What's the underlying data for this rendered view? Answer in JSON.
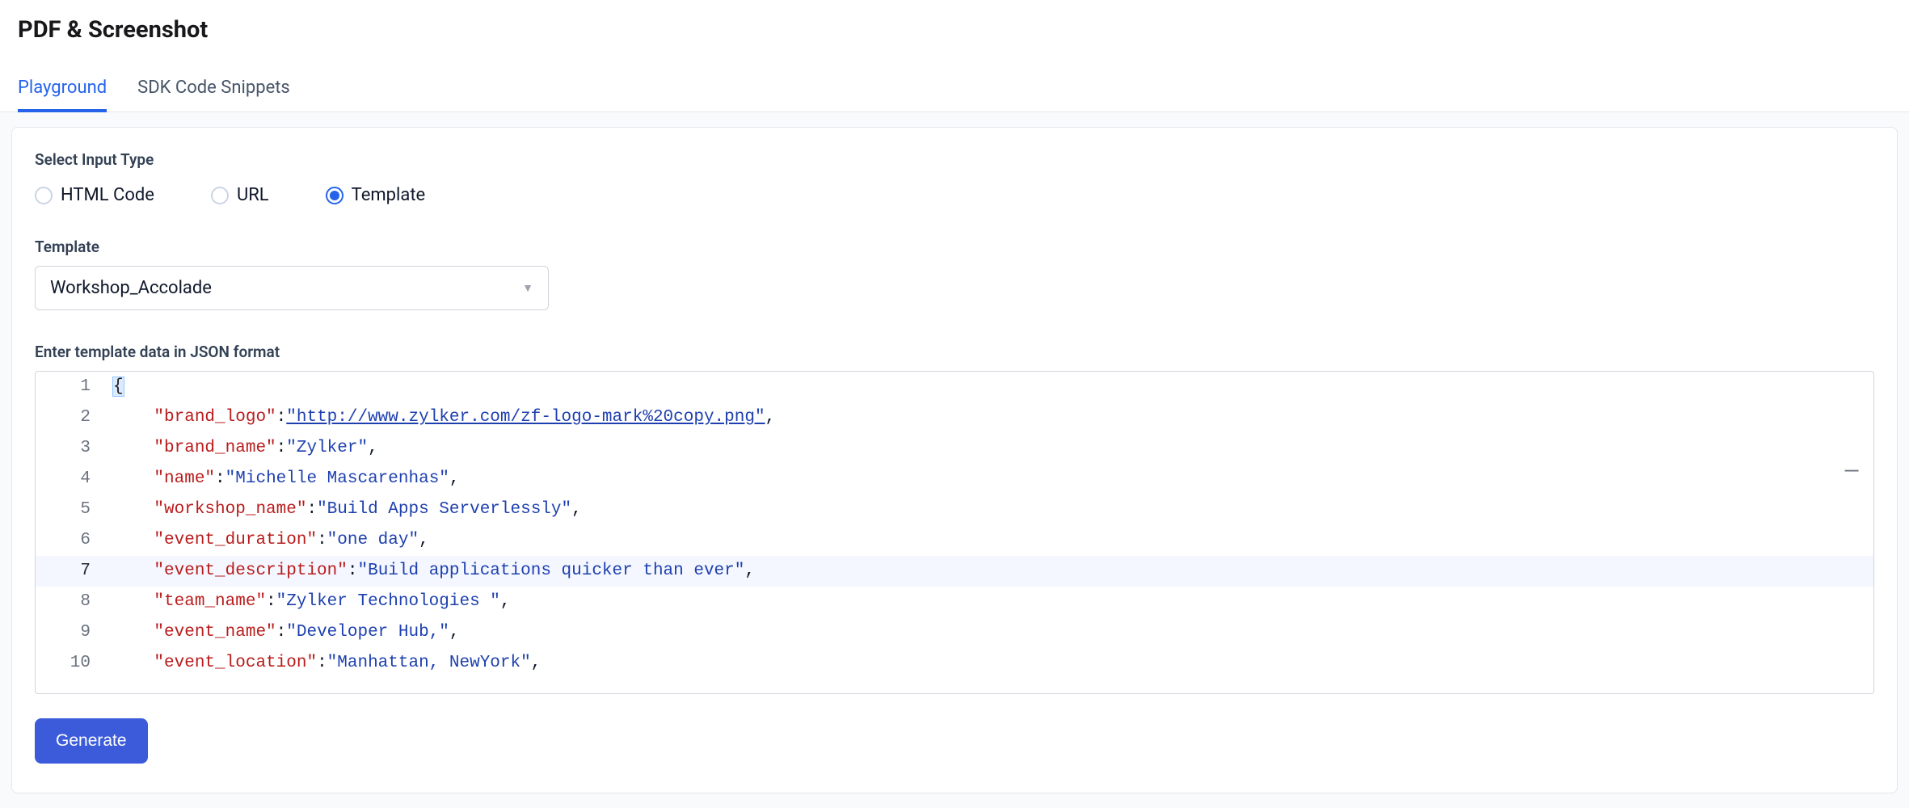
{
  "title": "PDF & Screenshot",
  "tabs": {
    "playground": "Playground",
    "sdk": "SDK Code Snippets"
  },
  "input_type": {
    "label": "Select Input Type",
    "options": {
      "html": "HTML Code",
      "url": "URL",
      "template": "Template"
    },
    "selected": "template"
  },
  "template_field": {
    "label": "Template",
    "value": "Workshop_Accolade"
  },
  "json_field": {
    "label": "Enter template data in JSON format",
    "lines": [
      {
        "n": "1",
        "tokens": [
          {
            "t": "punc",
            "v": "{"
          }
        ],
        "brace_hl": true
      },
      {
        "n": "2",
        "tokens": [
          {
            "t": "key",
            "v": "\"brand_logo\""
          },
          {
            "t": "punc",
            "v": ":"
          },
          {
            "t": "url",
            "v": "\"http://www.zylker.com/zf-logo-mark%20copy.png\""
          },
          {
            "t": "punc",
            "v": ","
          }
        ]
      },
      {
        "n": "3",
        "tokens": [
          {
            "t": "key",
            "v": "\"brand_name\""
          },
          {
            "t": "punc",
            "v": ":"
          },
          {
            "t": "str",
            "v": "\"Zylker\""
          },
          {
            "t": "punc",
            "v": ","
          }
        ]
      },
      {
        "n": "4",
        "tokens": [
          {
            "t": "key",
            "v": "\"name\""
          },
          {
            "t": "punc",
            "v": ":"
          },
          {
            "t": "str",
            "v": "\"Michelle Mascarenhas\""
          },
          {
            "t": "punc",
            "v": ","
          }
        ]
      },
      {
        "n": "5",
        "tokens": [
          {
            "t": "key",
            "v": "\"workshop_name\""
          },
          {
            "t": "punc",
            "v": ":"
          },
          {
            "t": "str",
            "v": "\"Build Apps Serverlessly\""
          },
          {
            "t": "punc",
            "v": ","
          }
        ]
      },
      {
        "n": "6",
        "tokens": [
          {
            "t": "key",
            "v": "\"event_duration\""
          },
          {
            "t": "punc",
            "v": ":"
          },
          {
            "t": "str",
            "v": "\"one day\""
          },
          {
            "t": "punc",
            "v": ","
          }
        ]
      },
      {
        "n": "7",
        "tokens": [
          {
            "t": "key",
            "v": "\"event_description\""
          },
          {
            "t": "punc",
            "v": ":"
          },
          {
            "t": "str",
            "v": "\"Build applications quicker than ever\""
          },
          {
            "t": "punc",
            "v": ","
          }
        ],
        "hl": true
      },
      {
        "n": "8",
        "tokens": [
          {
            "t": "key",
            "v": "\"team_name\""
          },
          {
            "t": "punc",
            "v": ":"
          },
          {
            "t": "str",
            "v": "\"Zylker Technologies \""
          },
          {
            "t": "punc",
            "v": ","
          }
        ]
      },
      {
        "n": "9",
        "tokens": [
          {
            "t": "key",
            "v": "\"event_name\""
          },
          {
            "t": "punc",
            "v": ":"
          },
          {
            "t": "str",
            "v": "\"Developer Hub,\""
          },
          {
            "t": "punc",
            "v": ","
          }
        ]
      },
      {
        "n": "10",
        "tokens": [
          {
            "t": "key",
            "v": "\"event_location\""
          },
          {
            "t": "punc",
            "v": ":"
          },
          {
            "t": "str",
            "v": "\"Manhattan, NewYork\""
          },
          {
            "t": "punc",
            "v": ","
          }
        ]
      }
    ]
  },
  "generate_button": "Generate",
  "collapse_icon": "—"
}
